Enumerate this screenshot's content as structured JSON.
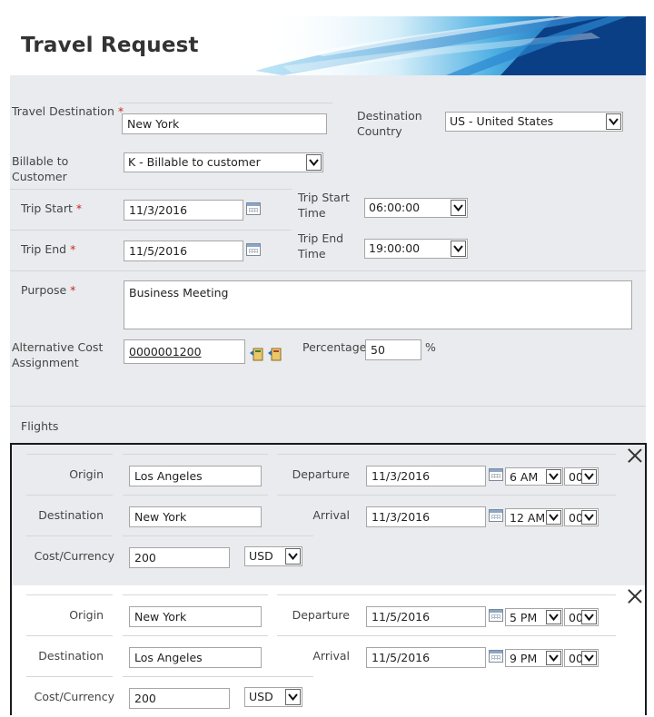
{
  "header": {
    "title": "Travel Request"
  },
  "form": {
    "travel_destination": {
      "label": "Travel Destination",
      "required_mark": "*",
      "value": "New York"
    },
    "destination_country": {
      "label_line1": "Destination",
      "label_line2": "Country",
      "value": "US - United States"
    },
    "billable": {
      "label_line1": "Billable to",
      "label_line2": "Customer",
      "value": "K - Billable to customer"
    },
    "trip_start": {
      "label": "Trip Start",
      "required_mark": "*",
      "value": "11/3/2016"
    },
    "trip_start_time": {
      "label_line1": "Trip Start",
      "label_line2": "Time",
      "value": "06:00:00"
    },
    "trip_end": {
      "label": "Trip End",
      "required_mark": "*",
      "value": "11/5/2016"
    },
    "trip_end_time": {
      "label_line1": "Trip End",
      "label_line2": "Time",
      "value": "19:00:00"
    },
    "purpose": {
      "label": "Purpose",
      "required_mark": "*",
      "value": "Business Meeting"
    },
    "alt_cost": {
      "label_line1": "Alternative Cost",
      "label_line2": "Assignment",
      "value": "0000001200"
    },
    "percentage": {
      "label": "Percentage",
      "value": "50",
      "unit": "%"
    },
    "flights_label": "Flights"
  },
  "flights": [
    {
      "origin_label": "Origin",
      "origin": "Los Angeles",
      "destination_label": "Destination",
      "destination": "New York",
      "cost_label": "Cost/Currency",
      "cost": "200",
      "currency": "USD",
      "departure_label": "Departure",
      "departure_date": "11/3/2016",
      "departure_hour": "6 AM",
      "departure_min": "00",
      "arrival_label": "Arrival",
      "arrival_date": "11/3/2016",
      "arrival_hour": "12 AM",
      "arrival_min": "00"
    },
    {
      "origin_label": "Origin",
      "origin": "New York",
      "destination_label": "Destination",
      "destination": "Los Angeles",
      "cost_label": "Cost/Currency",
      "cost": "200",
      "currency": "USD",
      "departure_label": "Departure",
      "departure_date": "11/5/2016",
      "departure_hour": "5 PM",
      "departure_min": "00",
      "arrival_label": "Arrival",
      "arrival_date": "11/5/2016",
      "arrival_hour": "9 PM",
      "arrival_min": "00"
    }
  ],
  "colors": {
    "header_blue": "#0a3f86",
    "form_bg": "#e9ebee",
    "required": "#c42b1c"
  },
  "icons": [
    "calendar-icon",
    "chevron-down-icon",
    "close-icon",
    "address-book-icon"
  ]
}
